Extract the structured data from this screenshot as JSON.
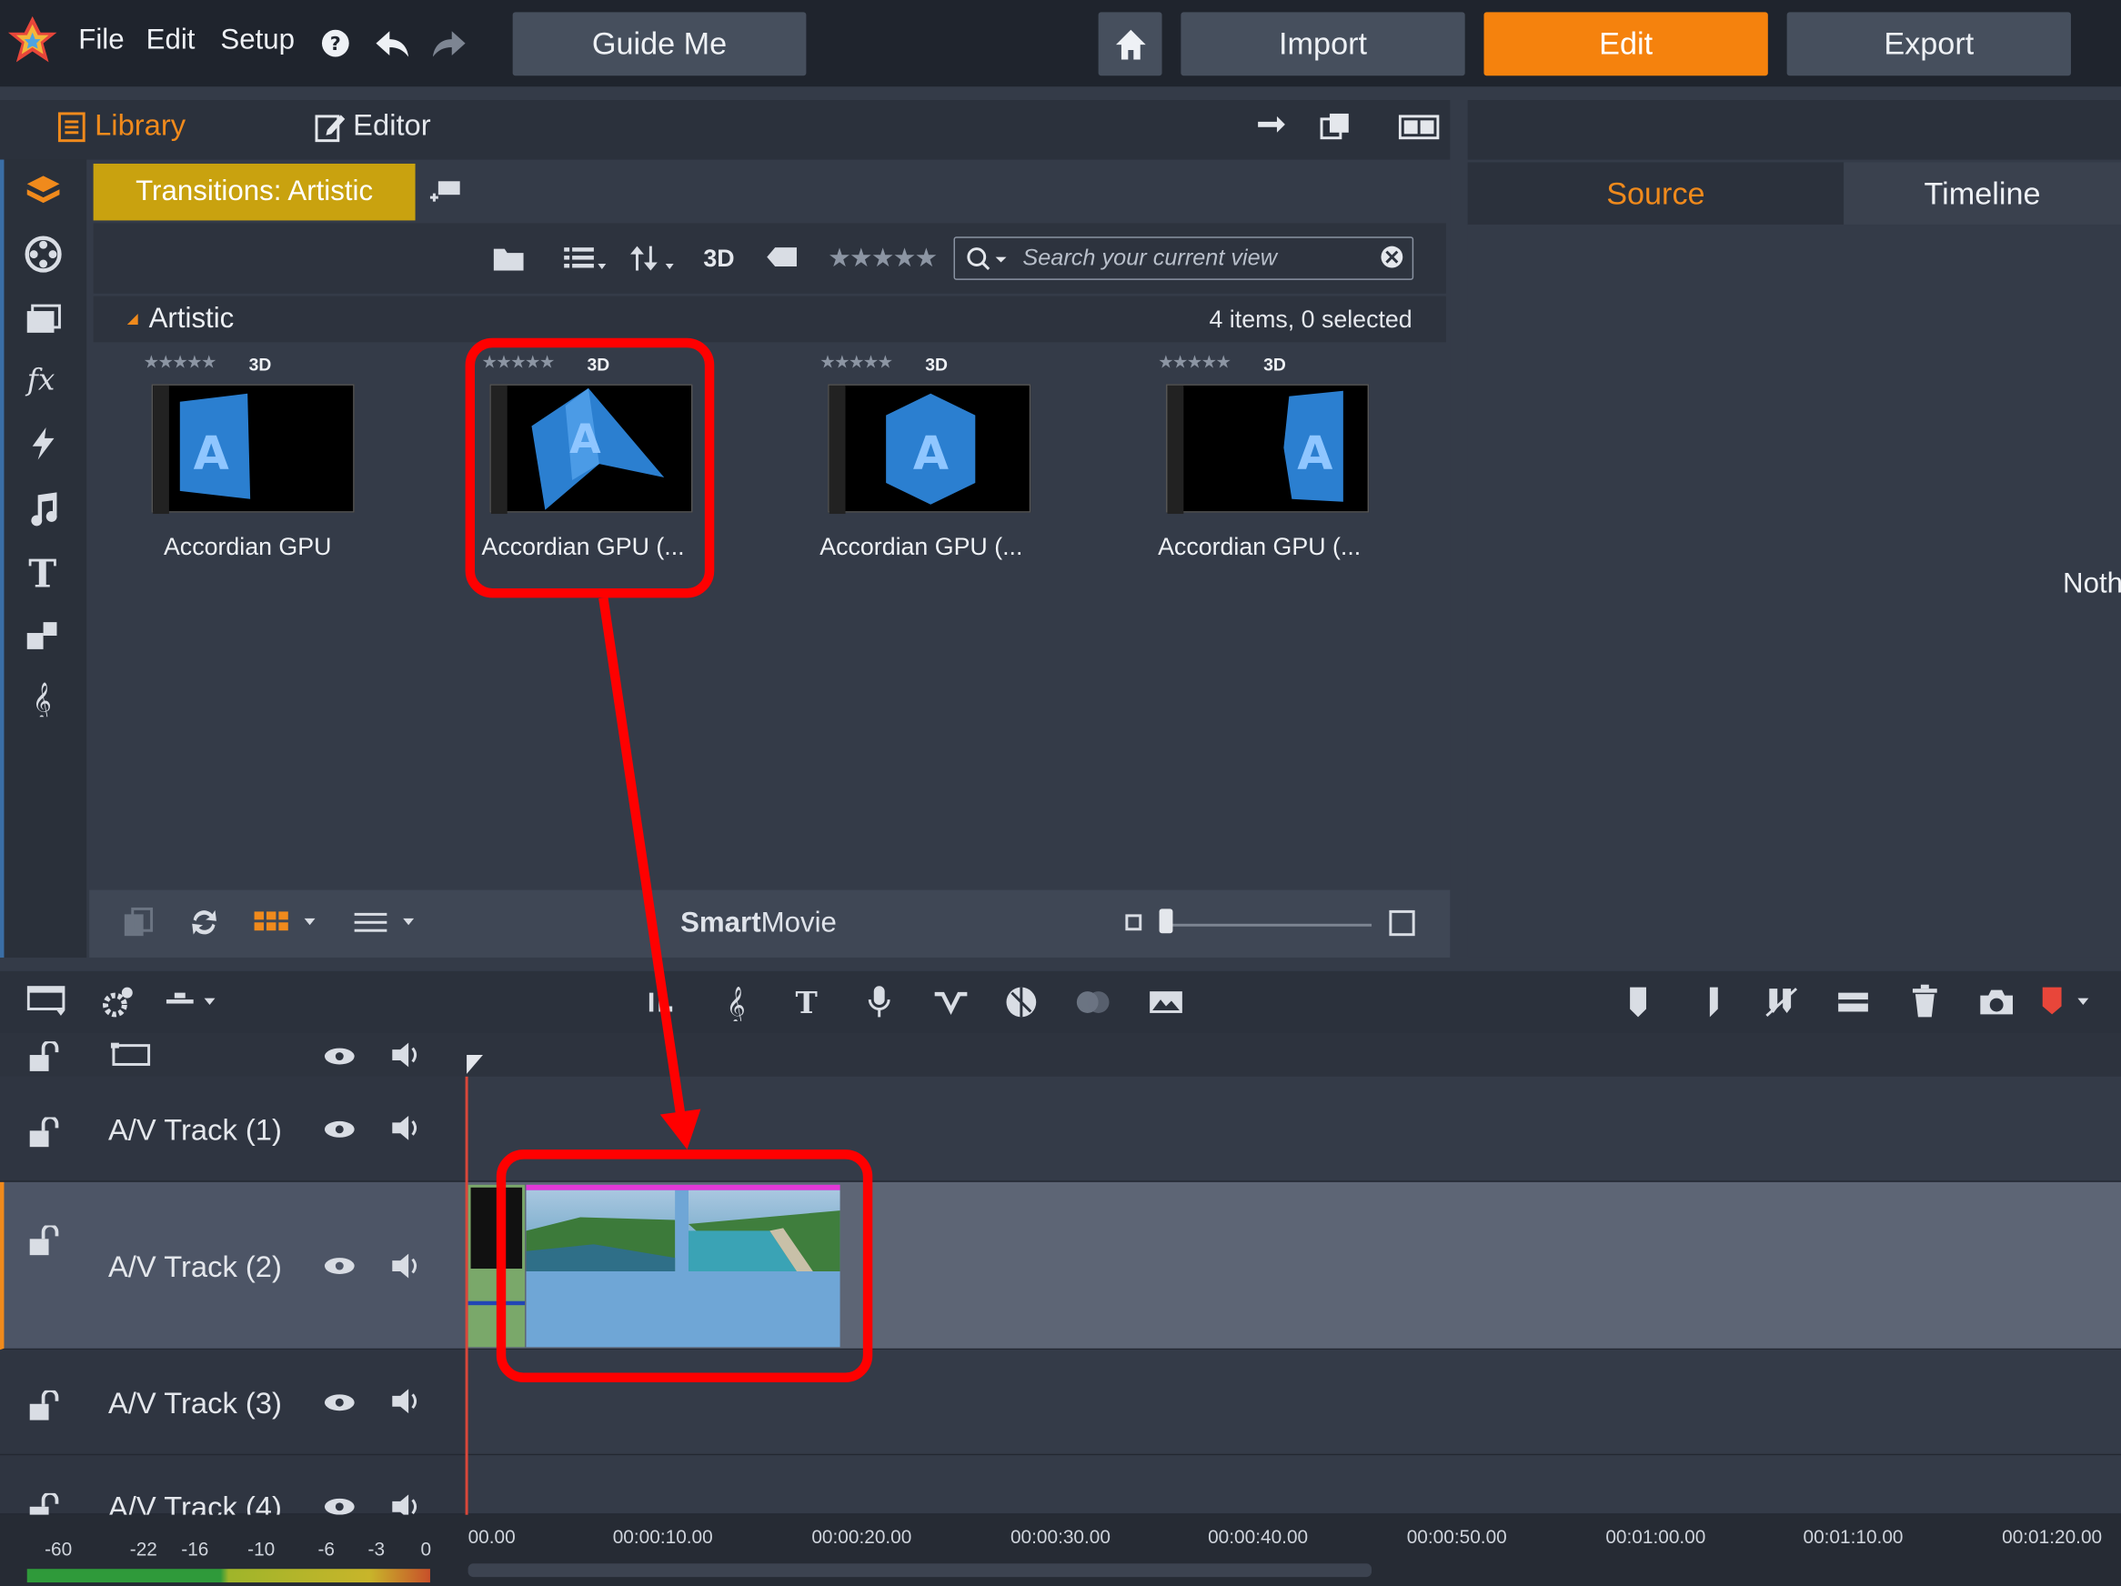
{
  "app": {
    "menu": [
      "File",
      "Edit",
      "Setup"
    ],
    "guide_me": "Guide Me",
    "nav_buttons": [
      "Import",
      "Edit",
      "Export"
    ],
    "active_nav": "Edit"
  },
  "library_tabs": {
    "library": "Library",
    "editor": "Editor"
  },
  "breadcrumb": "Transitions: Artistic",
  "toolbar": {
    "badge_3d": "3D",
    "search_placeholder": "Search your current view"
  },
  "group": {
    "name": "Artistic",
    "count_text": "4 items, 0 selected"
  },
  "items": [
    {
      "label": "Accordian GPU",
      "badge": "3D"
    },
    {
      "label": "Accordian GPU (...",
      "badge": "3D"
    },
    {
      "label": "Accordian GPU (...",
      "badge": "3D"
    },
    {
      "label": "Accordian GPU (...",
      "badge": "3D"
    }
  ],
  "footer": {
    "smartmovie_bold": "Smart",
    "smartmovie_rest": "Movie"
  },
  "preview": {
    "source_tab": "Source",
    "timeline_tab": "Timeline",
    "empty_text": "Noth"
  },
  "tracks": [
    "A/V Track (1)",
    "A/V Track (2)",
    "A/V Track (3)",
    "A/V Track (4)"
  ],
  "meter_labels": [
    "-60",
    "-22",
    "-16",
    "-10",
    "-6",
    "-3",
    "0"
  ],
  "ruler_ticks": [
    "00.00",
    "00:00:10.00",
    "00:00:20.00",
    "00:00:30.00",
    "00:00:40.00",
    "00:00:50.00",
    "00:01:00.00",
    "00:01:10.00",
    "00:01:20.00"
  ],
  "colors": {
    "accent": "#f5820d",
    "breadcrumb": "#c9a20f",
    "annotation": "#ff0000",
    "clip": "#6fa6d6"
  }
}
